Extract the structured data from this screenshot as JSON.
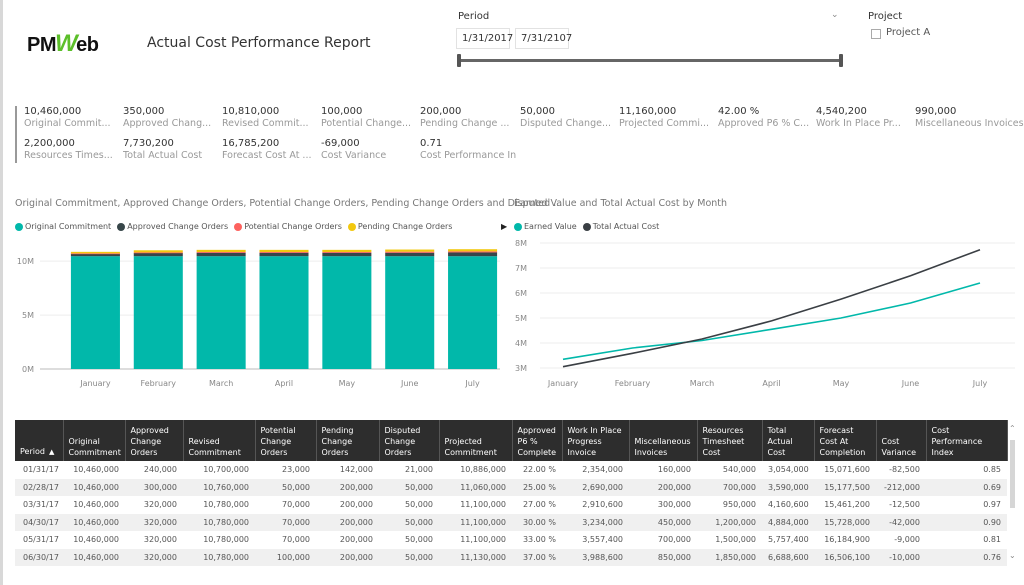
{
  "header": {
    "logo_left": "PM",
    "logo_w": "W",
    "logo_right": "eb",
    "title": "Actual Cost Performance Report"
  },
  "period": {
    "label": "Period",
    "start": "1/31/2017",
    "end": "7/31/2107",
    "range_fraction": [
      0,
      1
    ]
  },
  "project": {
    "label": "Project",
    "items": [
      {
        "label": "Project A",
        "checked": false
      }
    ]
  },
  "kpis": [
    {
      "value": "10,460,000",
      "label": "Original Commit..."
    },
    {
      "value": "350,000",
      "label": "Approved Chang..."
    },
    {
      "value": "10,810,000",
      "label": "Revised Commit..."
    },
    {
      "value": "100,000",
      "label": "Potential Change..."
    },
    {
      "value": "200,000",
      "label": "Pending Change ..."
    },
    {
      "value": "50,000",
      "label": "Disputed Change..."
    },
    {
      "value": "11,160,000",
      "label": "Projected Commi..."
    },
    {
      "value": "42.00 %",
      "label": "Approved P6 % C..."
    },
    {
      "value": "4,540,200",
      "label": "Work In Place Pr..."
    },
    {
      "value": "990,000",
      "label": "Miscellaneous Invoices"
    },
    {
      "value": "2,200,000",
      "label": "Resources Times..."
    },
    {
      "value": "7,730,200",
      "label": "Total Actual Cost"
    },
    {
      "value": "16,785,200",
      "label": "Forecast Cost At ..."
    },
    {
      "value": "-69,000",
      "label": "Cost Variance"
    },
    {
      "value": "0.71",
      "label": "Cost Performance In..."
    }
  ],
  "colors": {
    "teal": "#01b8aa",
    "dark": "#374649",
    "salmon": "#fd625e",
    "yellow": "#f2c80f",
    "linedark": "#3a3f44"
  },
  "chart_data": [
    {
      "type": "bar",
      "stacked": true,
      "title": "Original Commitment, Approved Change Orders, Potential Change Orders, Pending Change Orders and Disputed ...",
      "categories": [
        "January",
        "February",
        "March",
        "April",
        "May",
        "June",
        "July"
      ],
      "series": [
        {
          "name": "Original Commitment",
          "color": "#01b8aa",
          "values": [
            10460000,
            10460000,
            10460000,
            10460000,
            10460000,
            10460000,
            10460000
          ]
        },
        {
          "name": "Approved Change Orders",
          "color": "#374649",
          "values": [
            240000,
            300000,
            320000,
            320000,
            320000,
            320000,
            350000
          ]
        },
        {
          "name": "Potential Change Orders",
          "color": "#fd625e",
          "values": [
            23000,
            50000,
            70000,
            70000,
            70000,
            100000,
            100000
          ]
        },
        {
          "name": "Pending Change Orders",
          "color": "#f2c80f",
          "values": [
            142000,
            200000,
            200000,
            200000,
            200000,
            200000,
            200000
          ]
        }
      ],
      "yticks": [
        "0M",
        "5M",
        "10M"
      ],
      "ylim": [
        0,
        11500000
      ],
      "grid": true,
      "legend": "top-left"
    },
    {
      "type": "line",
      "title": "Earned Value and Total Actual Cost by Month",
      "categories": [
        "January",
        "February",
        "March",
        "April",
        "May",
        "June",
        "July"
      ],
      "series": [
        {
          "name": "Earned Value",
          "color": "#01b8aa",
          "values": [
            3350000,
            3800000,
            4100000,
            4550000,
            5000000,
            5600000,
            6400000
          ]
        },
        {
          "name": "Total Actual Cost",
          "color": "#3a3f44",
          "values": [
            3054000,
            3590000,
            4160600,
            4884000,
            5757400,
            6688600,
            7730200
          ]
        }
      ],
      "yticks": [
        "3M",
        "4M",
        "5M",
        "6M",
        "7M",
        "8M"
      ],
      "ylim": [
        3000000,
        8000000
      ],
      "grid": true,
      "legend": "top-left"
    }
  ],
  "table": {
    "columns": [
      "Period",
      "Original Commitment",
      "Approved Change Orders",
      "Revised Commitment",
      "Potential Change Orders",
      "Pending Change Orders",
      "Disputed Change Orders",
      "Projected Commitment",
      "Approved P6 % Complete",
      "Work In Place Progress Invoice",
      "Miscellaneous Invoices",
      "Resources Timesheet Cost",
      "Total Actual Cost",
      "Forecast Cost At Completion",
      "Cost Variance",
      "Cost Performance Index"
    ],
    "sort_column": "Period",
    "sort_direction": "ascending",
    "rows": [
      [
        "01/31/17",
        "10,460,000",
        "240,000",
        "10,700,000",
        "23,000",
        "142,000",
        "21,000",
        "10,886,000",
        "22.00 %",
        "2,354,000",
        "160,000",
        "540,000",
        "3,054,000",
        "15,071,600",
        "-82,500",
        "0.85"
      ],
      [
        "02/28/17",
        "10,460,000",
        "300,000",
        "10,760,000",
        "50,000",
        "200,000",
        "50,000",
        "11,060,000",
        "25.00 %",
        "2,690,000",
        "200,000",
        "700,000",
        "3,590,000",
        "15,177,500",
        "-212,000",
        "0.69"
      ],
      [
        "03/31/17",
        "10,460,000",
        "320,000",
        "10,780,000",
        "70,000",
        "200,000",
        "50,000",
        "11,100,000",
        "27.00 %",
        "2,910,600",
        "300,000",
        "950,000",
        "4,160,600",
        "15,461,200",
        "-12,500",
        "0.97"
      ],
      [
        "04/30/17",
        "10,460,000",
        "320,000",
        "10,780,000",
        "70,000",
        "200,000",
        "50,000",
        "11,100,000",
        "30.00 %",
        "3,234,000",
        "450,000",
        "1,200,000",
        "4,884,000",
        "15,728,000",
        "-42,000",
        "0.90"
      ],
      [
        "05/31/17",
        "10,460,000",
        "320,000",
        "10,780,000",
        "70,000",
        "200,000",
        "50,000",
        "11,100,000",
        "33.00 %",
        "3,557,400",
        "700,000",
        "1,500,000",
        "5,757,400",
        "16,184,900",
        "-9,000",
        "0.81"
      ],
      [
        "06/30/17",
        "10,460,000",
        "320,000",
        "10,780,000",
        "100,000",
        "200,000",
        "50,000",
        "11,130,000",
        "37.00 %",
        "3,988,600",
        "850,000",
        "1,850,000",
        "6,688,600",
        "16,506,100",
        "-10,000",
        "0.76"
      ]
    ]
  }
}
